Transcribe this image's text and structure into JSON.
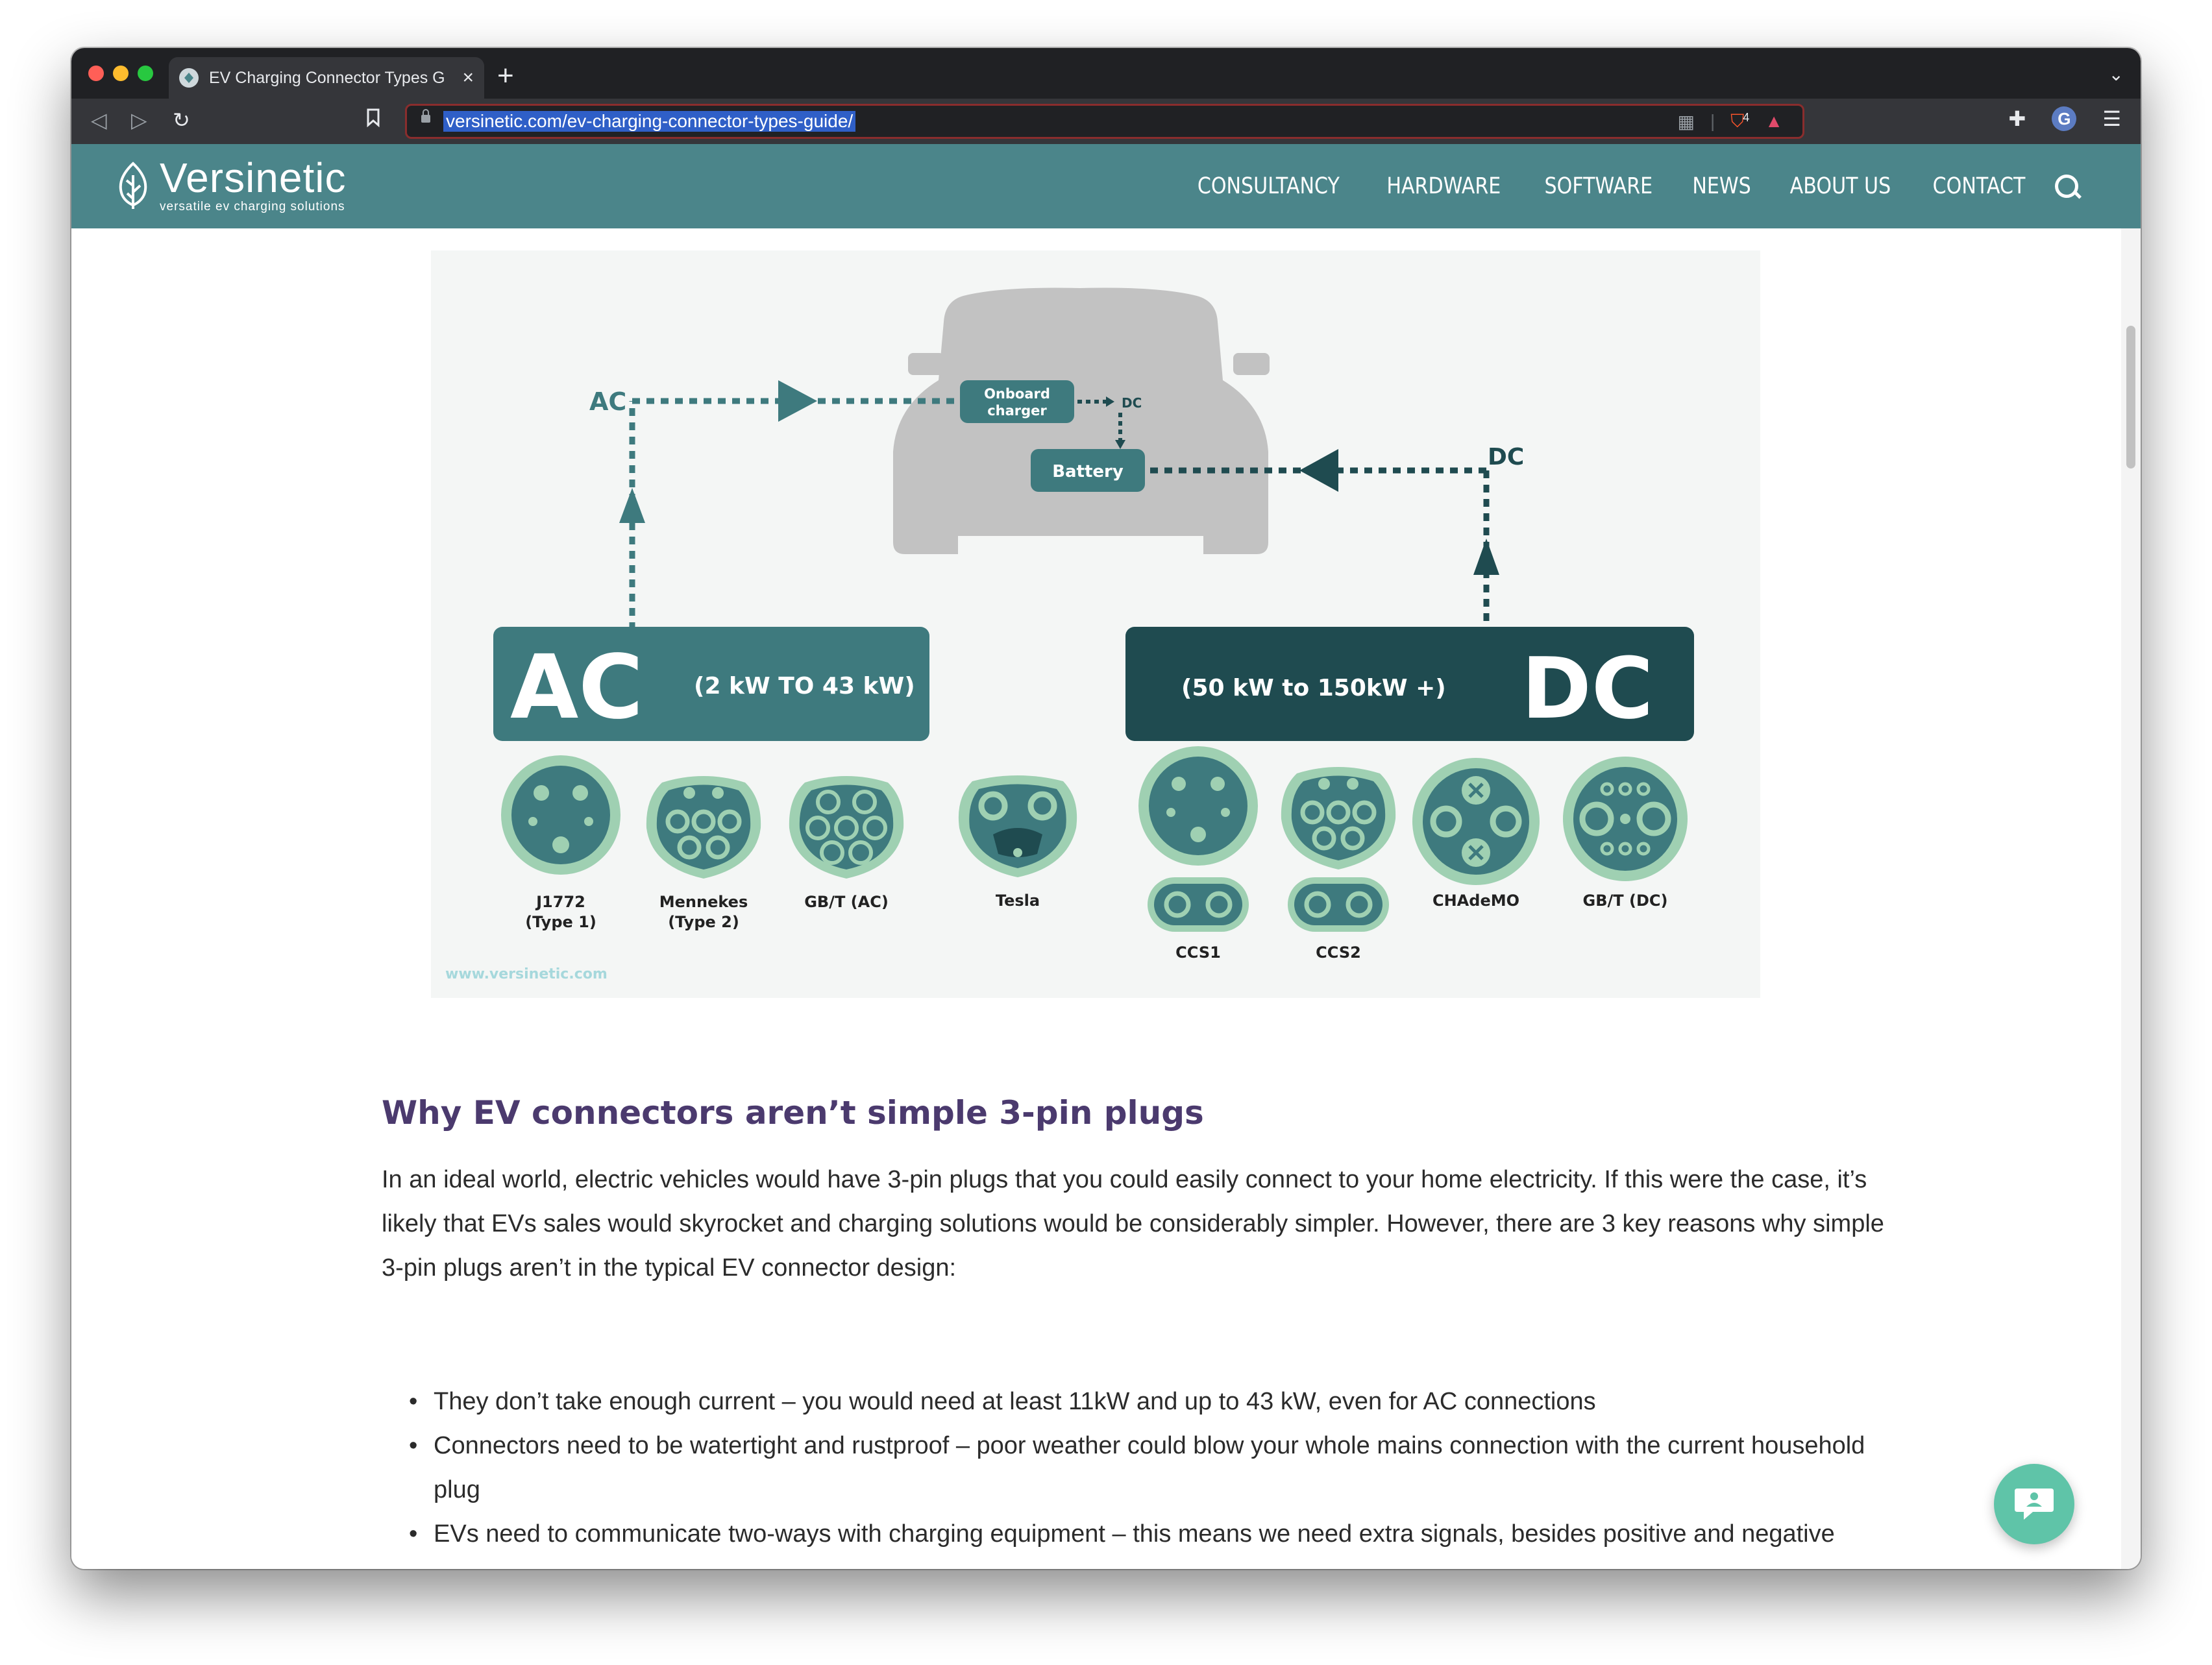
{
  "browser": {
    "tab_title": "EV Charging Connector Types G",
    "url": "versinetic.com/ev-charging-connector-types-guide/",
    "brave_badge": "4"
  },
  "site": {
    "logo_name": "Versinetic",
    "logo_tagline": "versatile ev charging solutions",
    "nav": [
      "CONSULTANCY",
      "HARDWARE",
      "SOFTWARE",
      "NEWS",
      "ABOUT US",
      "CONTACT"
    ]
  },
  "diagram": {
    "ac_top_label": "AC",
    "dc_top_label": "DC",
    "dc_small_label": "DC",
    "onboard_charger": [
      "Onboard",
      "charger"
    ],
    "battery": "Battery",
    "ac_big": "AC",
    "ac_range": "(2 kW TO 43 kW)",
    "dc_big": "DC",
    "dc_range": "(50 kW to 150kW +)",
    "connectors": {
      "j1772": [
        "J1772",
        "(Type 1)"
      ],
      "mennekes": [
        "Mennekes",
        "(Type 2)"
      ],
      "gbt_ac": "GB/T (AC)",
      "tesla": "Tesla",
      "ccs1": "CCS1",
      "ccs2": "CCS2",
      "chademo": "CHAdeMO",
      "gbt_dc": "GB/T (DC)"
    },
    "watermark": "www.versinetic.com"
  },
  "article": {
    "heading": "Why EV connectors aren’t simple 3-pin plugs",
    "paragraph": "In an ideal world, electric vehicles would have 3-pin plugs that you could easily connect to your home electricity. If this were the case, it’s likely that EVs sales would skyrocket and charging solutions would be considerably simpler. However, there are 3 key reasons why simple 3-pin plugs aren’t in the typical EV connector design:",
    "bullets": [
      "They don’t take enough current – you would need at least 11kW and up to 43 kW, even for AC connections",
      "Connectors need to be watertight and rustproof – poor weather could blow your whole mains connection with the current household plug",
      "EVs need to communicate two-ways with charging equipment – this means we need extra signals, besides positive and negative"
    ]
  },
  "icons": {
    "back": "back-arrow-icon",
    "forward": "forward-arrow-icon",
    "reload": "reload-icon",
    "bookmark": "bookmark-icon",
    "extensions": "puzzle-icon",
    "menu": "hamburger-menu-icon",
    "chat": "chat-bubble-icon"
  },
  "colors": {
    "brand_teal": "#4b858a",
    "dark_teal": "#1f4b50",
    "heading_purple": "#4b3a6e",
    "connector_light": "#9fd0b2"
  }
}
